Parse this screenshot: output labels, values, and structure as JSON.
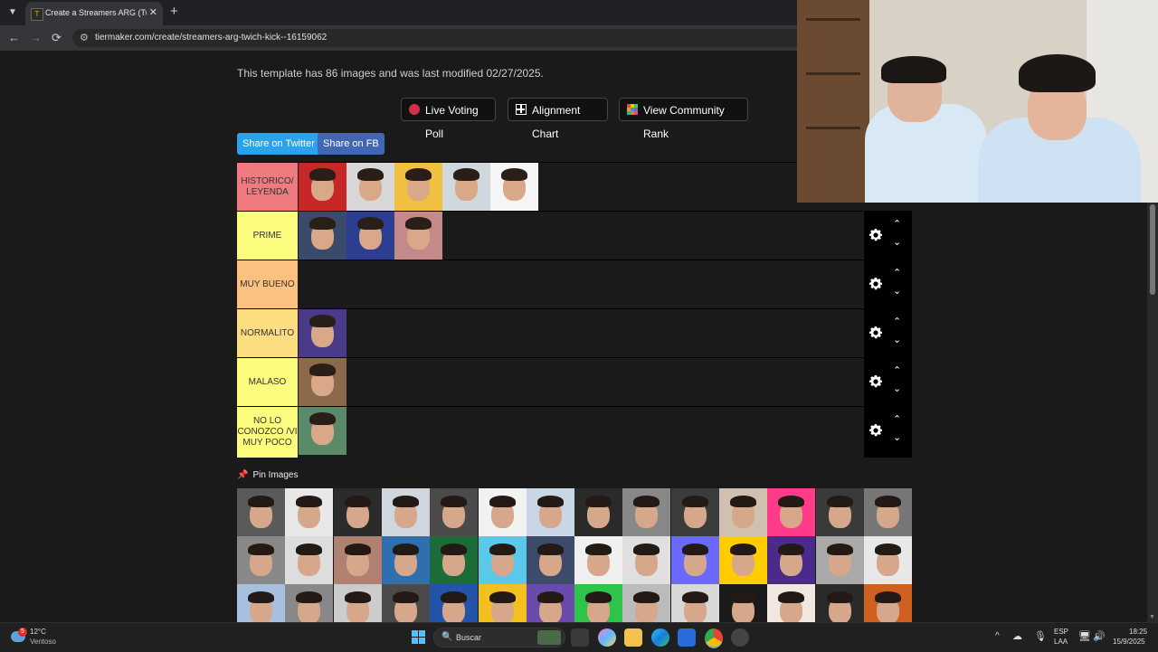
{
  "browser": {
    "tab_title": "Create a Streamers ARG (Twich",
    "tab_close": "✕",
    "new_tab": "+",
    "url": "tiermaker.com/create/streamers-arg-twich-kick--16159062",
    "back": "←",
    "forward": "→",
    "reload": "⟳"
  },
  "page": {
    "template_info": "This template has 86 images and was last modified 02/27/2025.",
    "buttons": {
      "live_voting": "Live Voting Poll",
      "alignment": "Alignment Chart",
      "community": "View Community Rank"
    },
    "share_twitter": "Share on Twitter",
    "share_fb": "Share on FB",
    "pin_images": "Pin Images"
  },
  "tiers": [
    {
      "label": "HISTORICO/ LEYENDA",
      "color": "#f07a7f",
      "count": 5
    },
    {
      "label": "PRIME",
      "color": "#fcfc7e",
      "count": 3
    },
    {
      "label": "MUY BUENO",
      "color": "#fbc180",
      "count": 0
    },
    {
      "label": "NORMALITO",
      "color": "#fcdd80",
      "count": 1
    },
    {
      "label": "MALASO",
      "color": "#fcfc7e",
      "count": 1
    },
    {
      "label": "NO LO CONOZCO /VI MUY POCO",
      "color": "#fcfc7e",
      "count": 1
    }
  ],
  "controls": {
    "up": "⌃",
    "down": "⌄"
  },
  "taskbar": {
    "temp": "12°C",
    "weather_desc": "Ventoso",
    "weather_badge": "5",
    "search": "Buscar",
    "lang1": "ESP",
    "lang2": "LAA",
    "time": "18:25",
    "date": "15/9/2025"
  },
  "colors": {
    "twitter": "#2aa3ef",
    "facebook": "#4267b2",
    "live_dot": "#d1304a"
  }
}
